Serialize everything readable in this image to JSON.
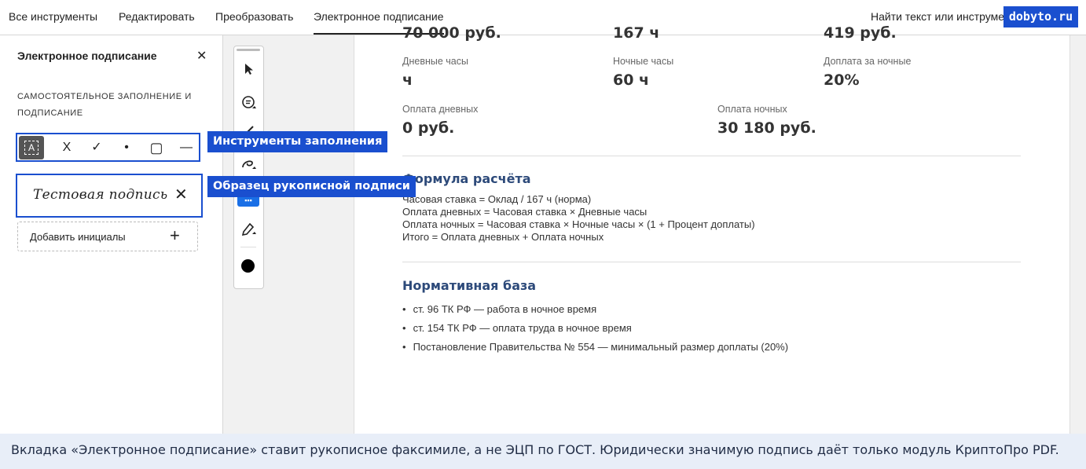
{
  "nav": {
    "tabs": [
      {
        "label": "Все инструменты"
      },
      {
        "label": "Редактировать"
      },
      {
        "label": "Преобразовать"
      },
      {
        "label": "Электронное подписание"
      }
    ],
    "search_text": "Найти текст или инструме",
    "watermark": "dobyto.ru"
  },
  "panel": {
    "title": "Электронное подписание",
    "close": "✕",
    "section_label": "САМОСТОЯТЕЛЬНОЕ ЗАПОЛНЕНИЕ И ПОДПИСАНИЕ",
    "tools": {
      "text": "A",
      "cross": "X",
      "check": "✓",
      "dot": "•",
      "rect": "▢",
      "line": "—"
    },
    "signature": "Тестовая подпись",
    "signature_remove": "✕",
    "initials_label": "Добавить инициалы",
    "initials_plus": "+"
  },
  "callouts": {
    "tools": "Инструменты заполнения",
    "signature": "Образец рукописной подписи"
  },
  "doc": {
    "cut_values": [
      "70 000 руб.",
      "167 ч",
      "419 руб."
    ],
    "row1": [
      {
        "label": "Дневные часы",
        "value": "ч"
      },
      {
        "label": "Ночные часы",
        "value": "60 ч"
      },
      {
        "label": "Доплата за ночные",
        "value": "20%"
      }
    ],
    "row2": [
      {
        "label": "Оплата дневных",
        "value": "0 руб."
      },
      {
        "label": "Оплата ночных",
        "value": "30 180 руб."
      }
    ],
    "formula_title": "Формула расчёта",
    "formula_lines": [
      "Часовая ставка = Оклад / 167 ч (норма)",
      "Оплата дневных = Часовая ставка × Дневные часы",
      "Оплата ночных = Часовая ставка × Ночные часы × (1 + Процент доплаты)",
      "Итого = Оплата дневных + Оплата ночных"
    ],
    "norms_title": "Нормативная база",
    "norms": [
      "ст. 96 ТК РФ — работа в ночное время",
      "ст. 154 ТК РФ — оплата труда в ночное время",
      "Постановление Правительства № 554 — минимальный размер доплаты (20%)"
    ]
  },
  "footer": "Вкладка «Электронное подписание» ставит рукописное факсимиле, а не ЭЦП по ГОСТ. Юридически значимую подпись даёт только модуль КриптоПро PDF."
}
